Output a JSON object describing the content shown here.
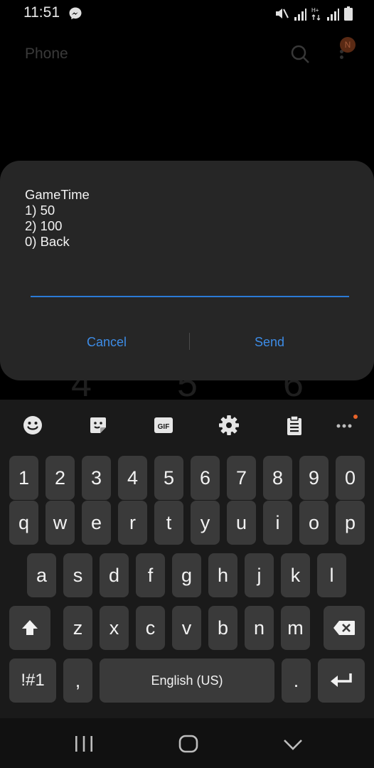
{
  "status_bar": {
    "time": "11:51",
    "icons": [
      "messenger-icon",
      "mute-icon",
      "signal-icon",
      "network-type-icon",
      "signal-icon",
      "battery-icon"
    ]
  },
  "background_app": {
    "title": "Phone",
    "avatar_initial": "N",
    "dialpad_partial": [
      "4",
      "5",
      "6"
    ]
  },
  "dialog": {
    "message_lines": [
      "GameTime",
      "1) 50",
      "2) 100",
      "0) Back"
    ],
    "input_value": "",
    "cancel_label": "Cancel",
    "send_label": "Send",
    "accent_color": "#3d8ce6"
  },
  "keyboard": {
    "toolbar": [
      "emoji-icon",
      "sticker-icon",
      "gif-icon",
      "settings-icon",
      "clipboard-icon",
      "more-icon"
    ],
    "gif_label": "GIF",
    "number_row": [
      "1",
      "2",
      "3",
      "4",
      "5",
      "6",
      "7",
      "8",
      "9",
      "0"
    ],
    "row1": [
      "q",
      "w",
      "e",
      "r",
      "t",
      "y",
      "u",
      "i",
      "o",
      "p"
    ],
    "row2": [
      "a",
      "s",
      "d",
      "f",
      "g",
      "h",
      "j",
      "k",
      "l"
    ],
    "row3": [
      "z",
      "x",
      "c",
      "v",
      "b",
      "n",
      "m"
    ],
    "symbols_label": "!#1",
    "comma_label": ",",
    "space_label": "English (US)",
    "period_label": "."
  },
  "navbar": [
    "recents-icon",
    "home-icon",
    "back-icon"
  ]
}
